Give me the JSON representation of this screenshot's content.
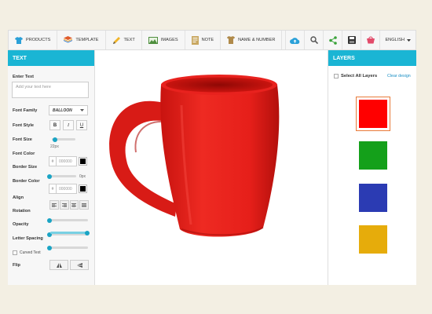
{
  "toolbar": {
    "items": [
      {
        "label": "PRODUCTS",
        "icon": "tshirt-icon"
      },
      {
        "label": "TEMPLATE",
        "icon": "layers-icon"
      },
      {
        "label": "TEXT",
        "icon": "pencil-icon"
      },
      {
        "label": "IMAGES",
        "icon": "image-icon"
      },
      {
        "label": "NOTE",
        "icon": "note-icon"
      },
      {
        "label": "NAME & NUMBER",
        "icon": "jersey-icon"
      }
    ],
    "actions": [
      "upload-cloud-icon",
      "zoom-icon",
      "share-icon",
      "save-icon",
      "cart-icon"
    ],
    "language": "ENGLISH"
  },
  "left_panel": {
    "title": "TEXT",
    "enter_text_label": "Enter Text",
    "text_placeholder": "Add your text here",
    "font_family_label": "Font Family",
    "font_family_value": "BALLOON",
    "font_style_label": "Font Style",
    "style_buttons": [
      "B",
      "I",
      "U"
    ],
    "font_size_label": "Font Size",
    "font_size_value": "22px",
    "font_color_label": "Font Color",
    "font_color_hex": "000000",
    "border_size_label": "Border Size",
    "border_size_value": "0px",
    "border_color_label": "Border Color",
    "border_color_hex": "000000",
    "align_label": "Align",
    "rotation_label": "Rotation",
    "opacity_label": "Opacity",
    "letter_spacing_label": "Letter Spacing",
    "curved_text_label": "Curved Text",
    "flip_label": "Flip",
    "hash": "#",
    "sliders": {
      "font_size": 0.1,
      "rotation": 0.0,
      "opacity": 0.0,
      "letter_spacing": 1.0,
      "curved": 0.0,
      "border_size": 0.0
    }
  },
  "canvas": {
    "product": "mug",
    "mug_color": "#e8221e"
  },
  "right_panel": {
    "title": "LAYERS",
    "select_all_label": "Select All Layers",
    "clear_label": "Clear design",
    "layer_colors": [
      "#ff0000",
      "#14a01a",
      "#2b3bb3",
      "#e6ac0b"
    ]
  },
  "colors": {
    "accent": "#1ab5d4",
    "selected_border": "#e87a3a"
  }
}
